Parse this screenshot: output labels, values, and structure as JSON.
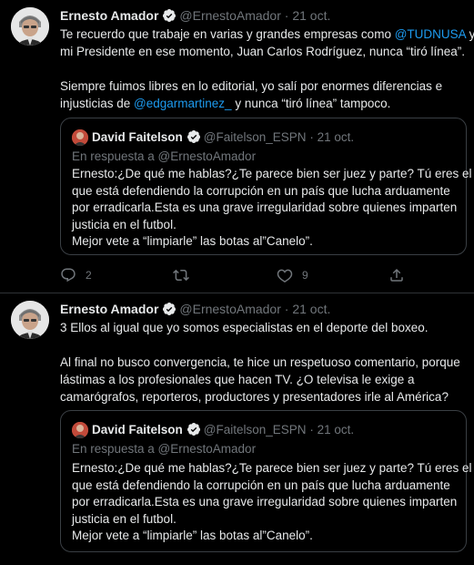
{
  "tweets": [
    {
      "author": "Ernesto Amador",
      "handle": "@ErnestoAmador",
      "separator": "·",
      "time": "21 oct.",
      "paragraph1": {
        "line1_a": "Te recuerdo que trabaje en varias y grandes empresas como ",
        "line1_link": "@TUDNUSA",
        "line1_b": " y",
        "line2": "mi Presidente en ese momento, Juan Carlos Rodríguez, nunca “tiró línea”."
      },
      "paragraph2": {
        "line1": "Siempre fuimos libres en lo editorial, yo salí por enormes diferencias e",
        "line2_a": "injusticias de ",
        "line2_link": "@edgarmartinez_",
        "line2_b": " y nunca “tiró línea” tampoco."
      },
      "quote": {
        "author": "David Faitelson",
        "handle": "@Faitelson_ESPN",
        "separator": "·",
        "time": "21 oct.",
        "reply_to": "En respuesta a @ErnestoAmador",
        "lines": [
          "Ernesto:¿De qué me hablas?¿Te parece bien ser juez y parte? Tú eres el",
          "que está defendiendo la corrupción en un país que lucha arduamente",
          "por erradicarla.Esta  es una grave irregularidad sobre quienes imparten",
          "justicia en el futbol.",
          "Mejor vete a “limpiarle” las botas al”Canelo”."
        ]
      },
      "actions": {
        "replies": "2",
        "retweets": "",
        "likes": "9"
      }
    },
    {
      "author": "Ernesto Amador",
      "handle": "@ErnestoAmador",
      "separator": "·",
      "time": "21 oct.",
      "paragraph1": {
        "line1": "3 Ellos al igual que yo somos especialistas en el deporte del boxeo."
      },
      "paragraph2": {
        "line1": "Al final no busco convergencia, te hice un respetuoso comentario, porque",
        "line2": "lástimas a los profesionales que hacen TV. ¿O televisa le exige a",
        "line3": "camarógrafos, reporteros, productores y presentadores irle al América?"
      },
      "quote": {
        "author": "David Faitelson",
        "handle": "@Faitelson_ESPN",
        "separator": "·",
        "time": "21 oct.",
        "reply_to": "En respuesta a @ErnestoAmador",
        "lines": [
          "Ernesto:¿De qué me hablas?¿Te parece bien ser juez y parte? Tú eres el",
          "que está defendiendo la corrupción en un país que lucha arduamente",
          "por erradicarla.Esta  es una grave irregularidad sobre quienes imparten",
          "justicia en el futbol.",
          "Mejor vete a “limpiarle” las botas al”Canelo”."
        ]
      }
    }
  ],
  "colors": {
    "background": "#000000",
    "text": "#e7e9ea",
    "secondary": "#71767b",
    "link": "#1d9bf0",
    "border": "#2f3336",
    "verified": "#1d9bf0"
  },
  "icons": [
    "reply-icon",
    "retweet-icon",
    "like-icon",
    "share-icon",
    "verified-badge-icon"
  ]
}
